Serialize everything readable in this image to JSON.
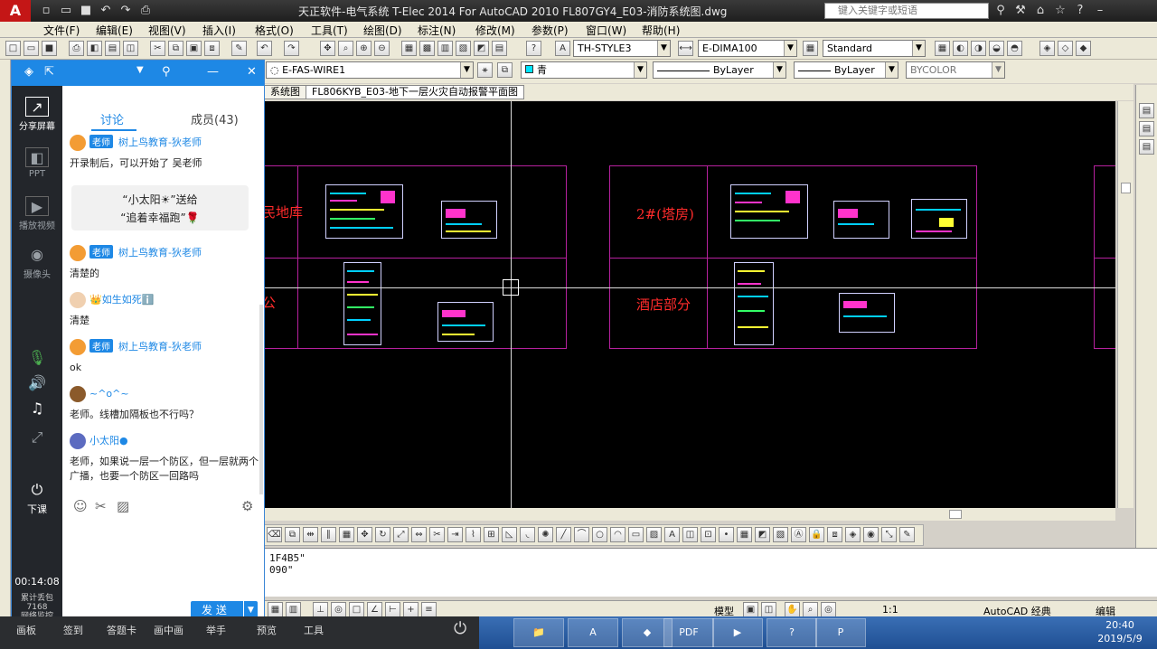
{
  "titlebar": {
    "title": "天正软件-电气系统 T-Elec 2014  For AutoCAD 2010    FL807GY4_E03-消防系统图.dwg",
    "search_placeholder": "键入关键字或短语"
  },
  "menu": [
    "文件(F)",
    "编辑(E)",
    "视图(V)",
    "插入(I)",
    "格式(O)",
    "工具(T)",
    "绘图(D)",
    "标注(N)",
    "修改(M)",
    "参数(P)",
    "窗口(W)",
    "帮助(H)"
  ],
  "toolbar": {
    "text_style": "TH-STYLE3",
    "dim_style": "E-DIMA100",
    "table_style": "Standard",
    "layer": "E-FAS-WIRE1",
    "color": "青",
    "linetype": "ByLayer",
    "lineweight": "ByLayer",
    "plotstyle": "BYCOLOR"
  },
  "drawing_tabs": [
    "系统图",
    "FL806KYB_E03-地下一层火灾自动报警平面图"
  ],
  "cad": {
    "labels": {
      "garage": "民地库",
      "tower2": "2#(塔房)",
      "hotel": "酒店部分",
      "partial": "公"
    }
  },
  "command": {
    "line1": "1F4B5\"",
    "line2": "090\""
  },
  "statusbar": {
    "model": "模型",
    "scale": "1:1",
    "workspace": "AutoCAD 经典",
    "edit": "编辑"
  },
  "chat": {
    "tabs": [
      "讨论",
      "成员(43)"
    ],
    "sidebar": [
      "分享屏幕",
      "PPT",
      "播放视频",
      "摄像头",
      "下课"
    ],
    "timer": "00:14:08",
    "stats": [
      "累计丢包",
      "7168",
      "网络监控"
    ],
    "send_label": "发 送",
    "messages": [
      {
        "badge": "老师",
        "name": "树上鸟教育-狄老师",
        "text": "开录制后，可以开始了 吴老师"
      },
      {
        "gift_line1": "“小太阳☀”送给",
        "gift_line2": "“追着幸福跑”🌹"
      },
      {
        "badge": "老师",
        "name": "树上鸟教育-狄老师",
        "text": "清楚的"
      },
      {
        "name": "👑如生如死ℹ️",
        "text": "清楚"
      },
      {
        "badge": "老师",
        "name": "树上鸟教育-狄老师",
        "text": "ok"
      },
      {
        "name": "~^o^~",
        "text": "老师。线槽加隔板也不行吗？"
      },
      {
        "name": "小太阳●",
        "text": "老师，如果说一层一个防区，但一层就两个广播，也要一个防区一回路吗"
      }
    ]
  },
  "classbar": [
    "画板",
    "签到",
    "答题卡",
    "画中画",
    "举手",
    "预览",
    "工具"
  ],
  "clock": {
    "time": "20:40",
    "date": "2019/5/9"
  }
}
